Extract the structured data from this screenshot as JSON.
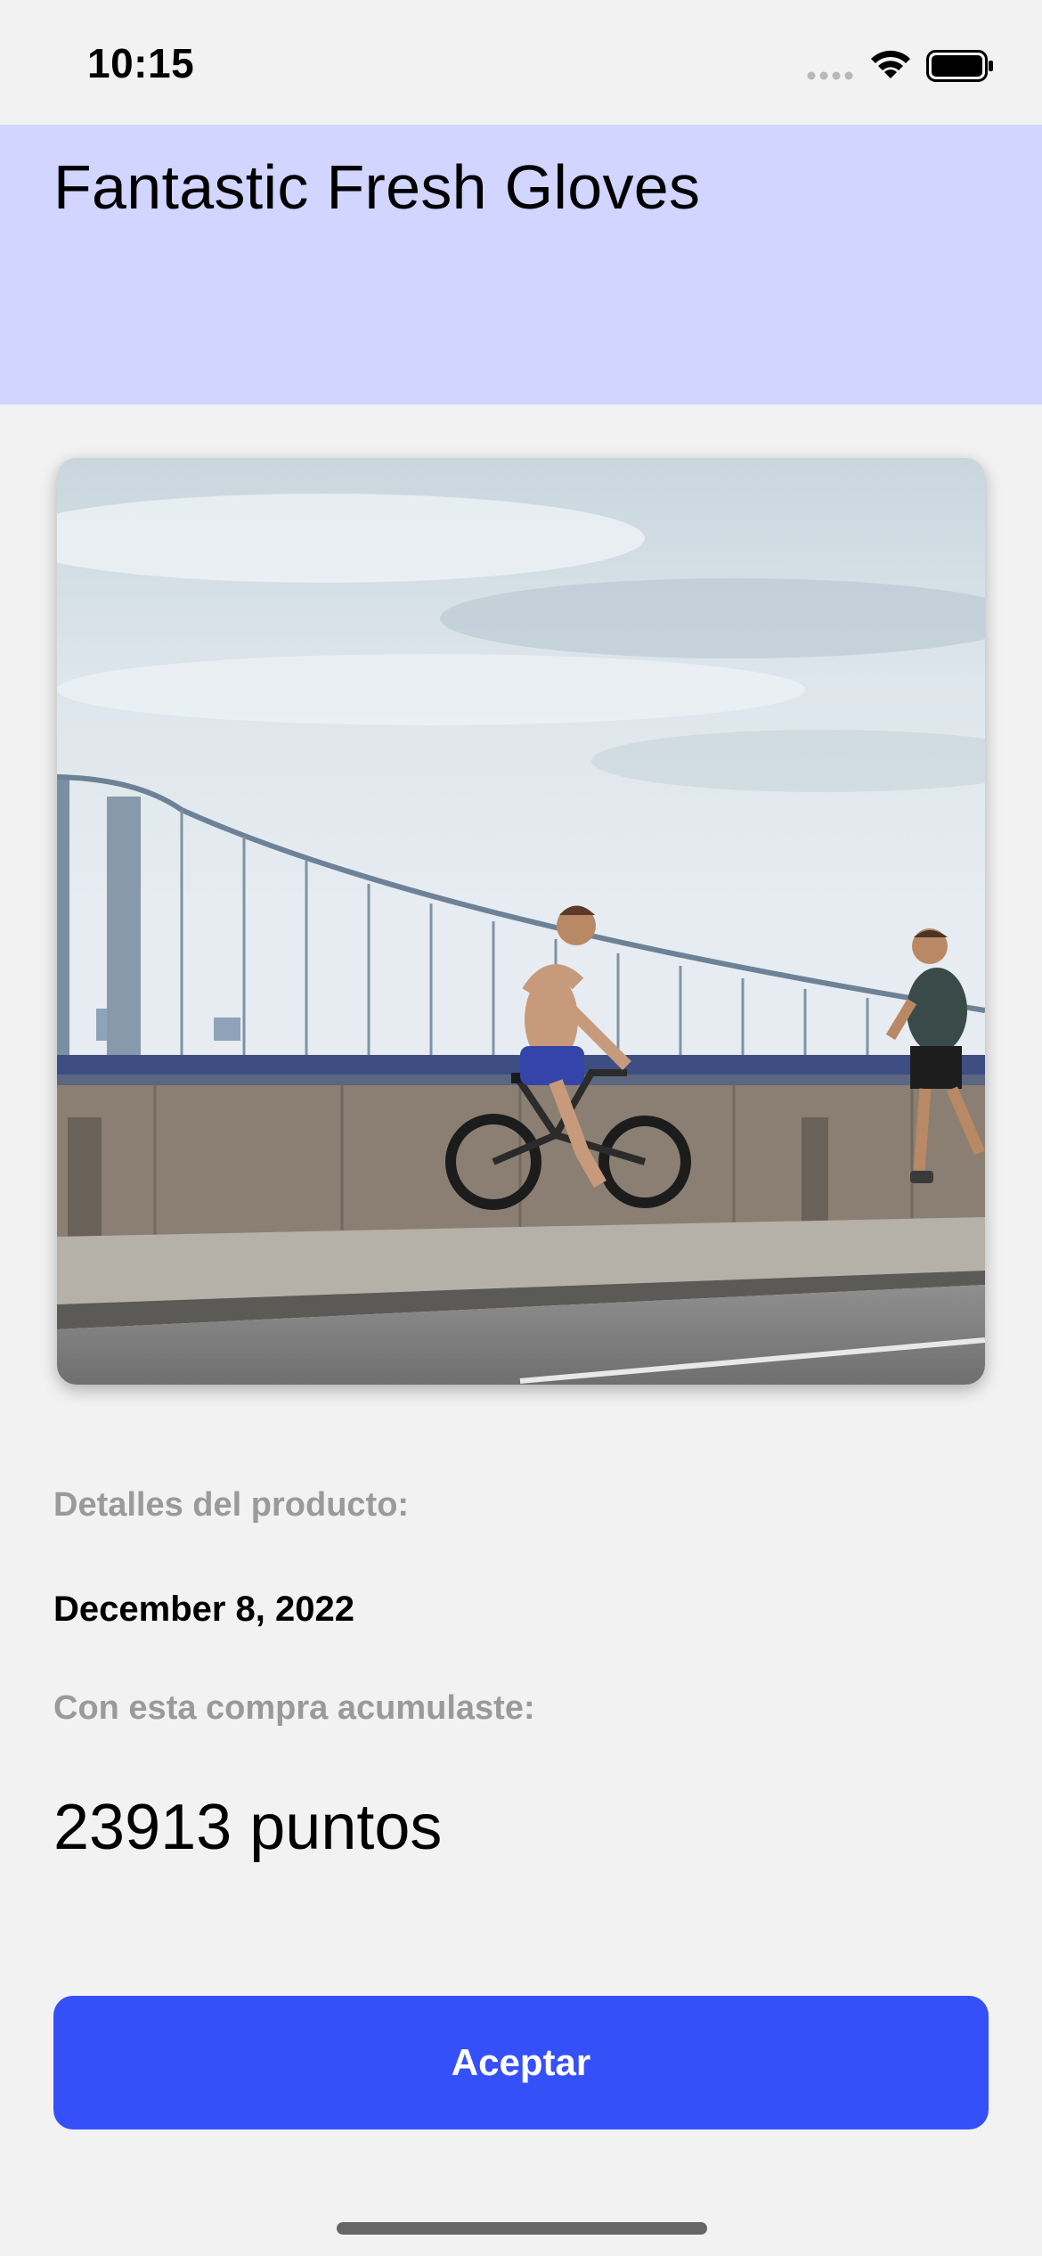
{
  "status_bar": {
    "time": "10:15",
    "icons": [
      "signal-dots-icon",
      "wifi-icon",
      "battery-icon"
    ]
  },
  "header": {
    "title": "Fantastic Fresh Gloves",
    "background_color": "#d1d5ff"
  },
  "product": {
    "image_icon": "product-photo"
  },
  "details": {
    "label": "Detalles del producto:",
    "date": "December 8, 2022"
  },
  "points": {
    "label": "Con esta compra acumulaste:",
    "value": "23913",
    "unit": "puntos"
  },
  "actions": {
    "accept_label": "Aceptar",
    "accent_color": "#3550f8"
  }
}
